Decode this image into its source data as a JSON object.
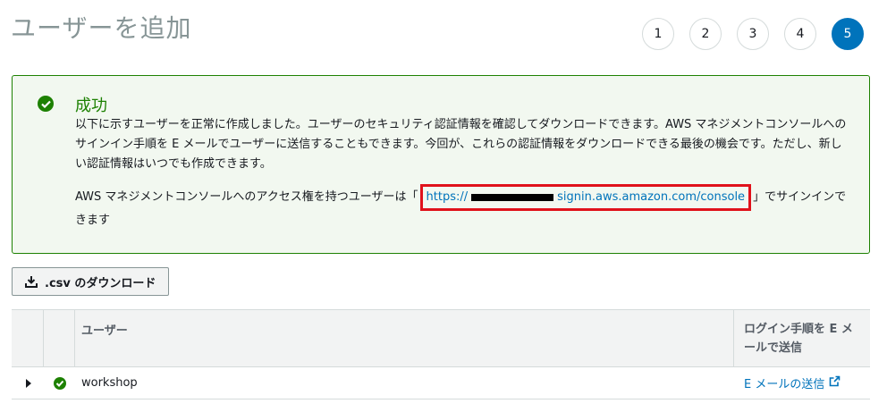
{
  "header": {
    "title": "ユーザーを追加"
  },
  "steps": [
    "1",
    "2",
    "3",
    "4",
    "5"
  ],
  "active_step": "5",
  "success": {
    "title": "成功",
    "body": "以下に示すユーザーを正常に作成しました。ユーザーのセキュリティ認証情報を確認してダウンロードできます。AWS マネジメントコンソールへのサインイン手順を E メールでユーザーに送信することもできます。今回が、これらの認証情報をダウンロードできる最後の機会です。ただし、新しい認証情報はいつでも作成できます。",
    "access_prefix": "AWS マネジメントコンソールへのアクセス権を持つユーザーは「",
    "url_start": "https://",
    "url_end": "signin.aws.amazon.com/console",
    "access_suffix": "」でサインインできます"
  },
  "download_button": {
    "label": ".csv のダウンロード",
    "icon": "download-icon"
  },
  "table": {
    "headers": {
      "user": "ユーザー",
      "email": "ログイン手順を E メールで送信"
    },
    "rows": [
      {
        "user": "workshop",
        "email_action": "E メールの送信",
        "status_icon": "check-circle-icon",
        "expand_icon": "caret-right-icon"
      }
    ]
  },
  "colors": {
    "success": "#1d8102",
    "accent": "#0073bb",
    "highlight": "#e0121b"
  }
}
